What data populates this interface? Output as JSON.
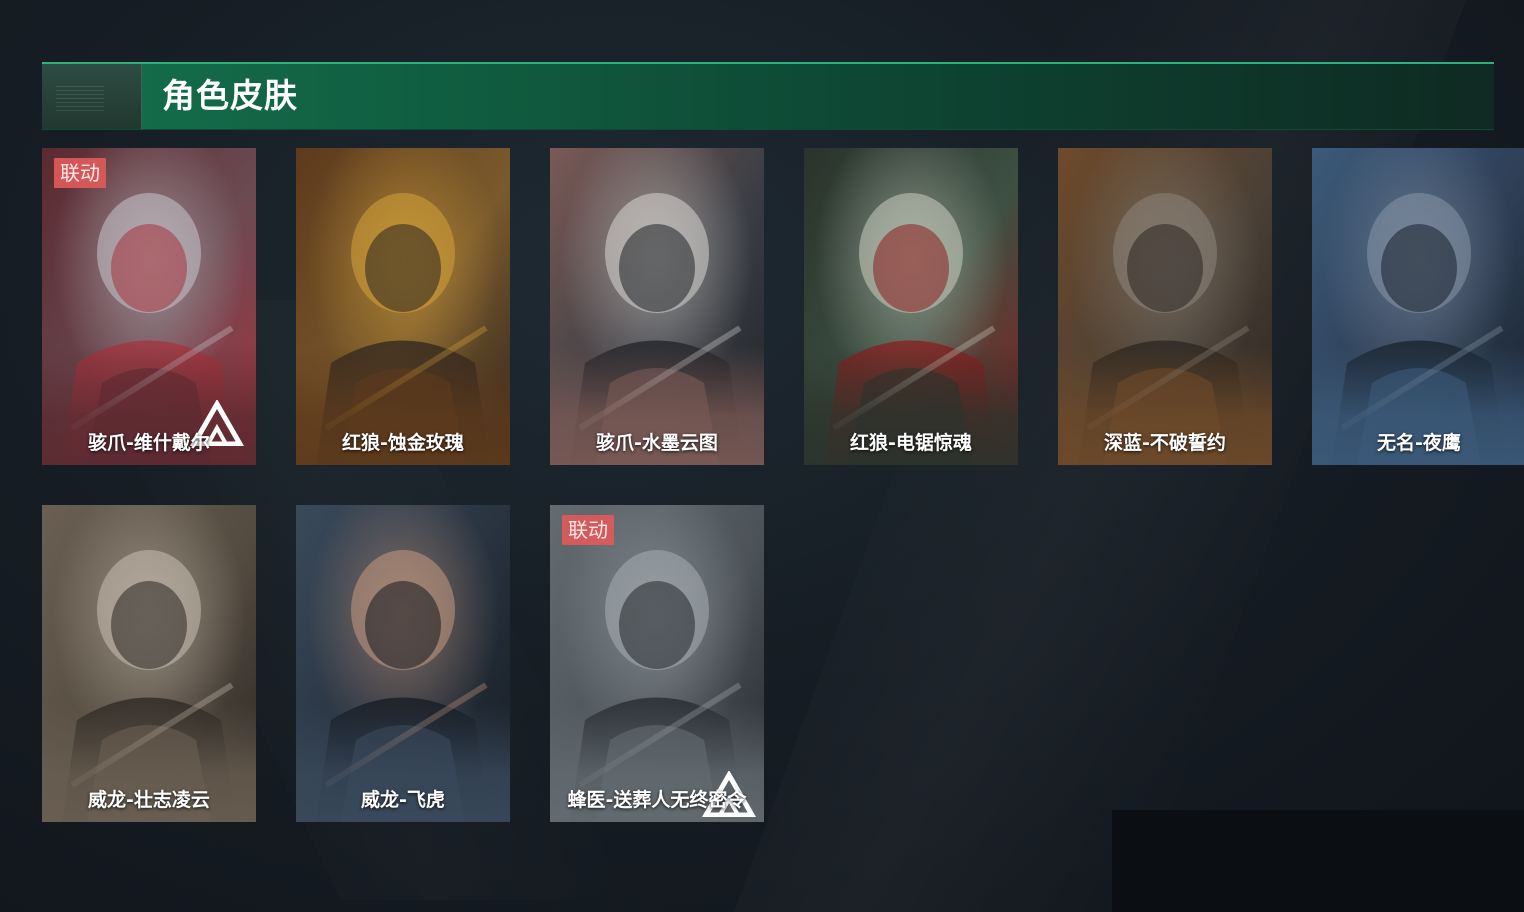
{
  "section": {
    "title": "角色皮肤"
  },
  "skins": [
    {
      "name": "骇爪-维什戴尔",
      "badge": "联动",
      "palette": [
        "#6b4a52",
        "#c7c6cc",
        "#a5333d",
        "#5a2a30"
      ]
    },
    {
      "name": "红狼-蚀金玫瑰",
      "badge": "",
      "palette": [
        "#7a5a2c",
        "#d4a33b",
        "#2e2620",
        "#5d3a1c"
      ]
    },
    {
      "name": "骇爪-水墨云图",
      "badge": "",
      "palette": [
        "#3b3e44",
        "#d7d5d2",
        "#1f2227",
        "#7a5a55"
      ]
    },
    {
      "name": "红狼-电锯惊魂",
      "badge": "",
      "palette": [
        "#3d5042",
        "#c8cdbf",
        "#8a1d1d",
        "#2a332c"
      ]
    },
    {
      "name": "深蓝-不破誓约",
      "badge": "",
      "palette": [
        "#4a4036",
        "#8d857b",
        "#2b2520",
        "#6e4a2a"
      ]
    },
    {
      "name": "无名-夜鹰",
      "badge": "",
      "palette": [
        "#2e3e55",
        "#8996a8",
        "#18212c",
        "#3c5a7a"
      ]
    },
    {
      "name": "威龙-壮志凌云",
      "badge": "",
      "palette": [
        "#544b40",
        "#c9c0b3",
        "#2a2622",
        "#6a5f52"
      ]
    },
    {
      "name": "威龙-飞虎",
      "badge": "",
      "palette": [
        "#27313d",
        "#c79a80",
        "#141a21",
        "#3a4a5c"
      ]
    },
    {
      "name": "蜂医-送葬人无终密令",
      "badge": "联动",
      "palette": [
        "#4b5258",
        "#a7aeb2",
        "#23282c",
        "#646c72"
      ]
    }
  ]
}
